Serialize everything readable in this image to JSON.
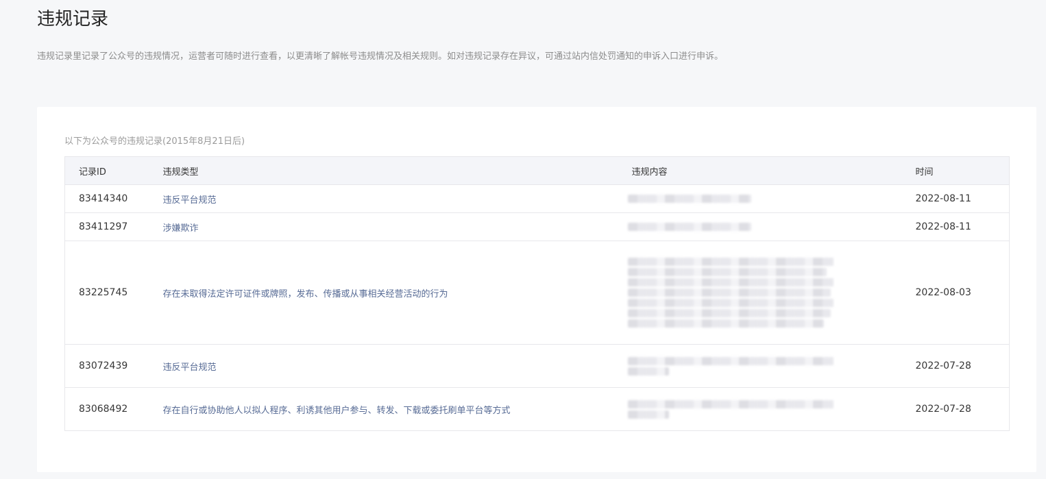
{
  "page": {
    "title": "违规记录",
    "description": "违规记录里记录了公众号的违规情况，运营者可随时进行查看，以更清晰了解帐号违规情况及相关规则。如对违规记录存在异议，可通过站内信处罚通知的申诉入口进行申诉。"
  },
  "card": {
    "caption": "以下为公众号的违规记录(2015年8月21日后)"
  },
  "table": {
    "headers": {
      "id": "记录ID",
      "type": "违规类型",
      "content": "违规内容",
      "time": "时间"
    },
    "rows": [
      {
        "id": "83414340",
        "type": "违反平台规范",
        "time": "2022-08-11"
      },
      {
        "id": "83411297",
        "type": "涉嫌欺诈",
        "time": "2022-08-11"
      },
      {
        "id": "83225745",
        "type": "存在未取得法定许可证件或牌照，发布、传播或从事相关经营活动的行为",
        "time": "2022-08-03"
      },
      {
        "id": "83072439",
        "type": "违反平台规范",
        "time": "2022-07-28"
      },
      {
        "id": "83068492",
        "type": "存在自行或协助他人以拟人程序、利诱其他用户参与、转发、下载或委托刷单平台等方式",
        "time": "2022-07-28"
      }
    ]
  }
}
